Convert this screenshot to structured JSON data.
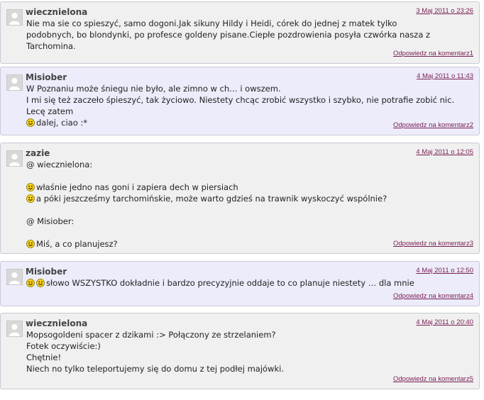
{
  "comments": [
    {
      "author": "wiecznielona",
      "date": "3 Maj 2011 o 23:26",
      "lines": [
        "Nie ma sie co spieszyć, samo dogoni.Jak sikuny Hildy i Heidi, córek do jednej z matek tylko",
        "podobnych, bo blondynki, po profesce goldeny pisane.Ciepłe pozdrowienia posyła czwórka nasza z Tarchomina."
      ],
      "reply": "Odpowiedz na komentarz1"
    },
    {
      "author": "Misiober",
      "date": "4 Maj 2011 o 11:43",
      "lines": [
        "W Poznaniu może śniegu nie było, ale zimno w ch… i owszem.",
        "I mi się też zaczeło śpieszyć, tak życiowo. Niestety chcąc zrobić wszystko i szybko, nie potrafie zobić nic. Lecę zatem",
        "dalej, ciao :*"
      ],
      "reply": "Odpowiedz na komentarz2"
    },
    {
      "author": "zazie",
      "date": "4 Maj 2011 o 12:05",
      "lines": [
        "@ wiecznielona:",
        "właśnie jedno nas goni i zapiera dech w piersiach",
        "a póki jeszcześmy tarchomińskie, może warto gdzieś na trawnik wyskoczyć wspólnie?",
        "@ Misiober:",
        "Miś, a co planujesz?"
      ],
      "reply": "Odpowiedz na komentarz3"
    },
    {
      "author": "Misiober",
      "date": "4 Maj 2011 o 12:50",
      "lines": [
        "słowo WSZYSTKO dokładnie i bardzo precyzyjnie oddaje to co planuje niestety … dla mnie"
      ],
      "reply": "Odpowiedz na komentarz4"
    },
    {
      "author": "wiecznielona",
      "date": "4 Maj 2011 o 20:40",
      "lines": [
        "Mopsogoldeni spacer z dzikami :> Połączony ze strzelaniem?",
        "Fotek oczywiście:)",
        "Chętnie!",
        "Niech no tylko teleportujemy się do domu z tej podłej majówki."
      ],
      "reply": "Odpowiedz na komentarz5"
    }
  ],
  "icons": {
    "avatar": "default-avatar-icon",
    "smiley": "smiley-icon"
  },
  "colors": {
    "link": "#7a1f55",
    "bg_alt": "#ececfa",
    "bg": "#f0f0f0",
    "smiley": "#f5d31a"
  }
}
